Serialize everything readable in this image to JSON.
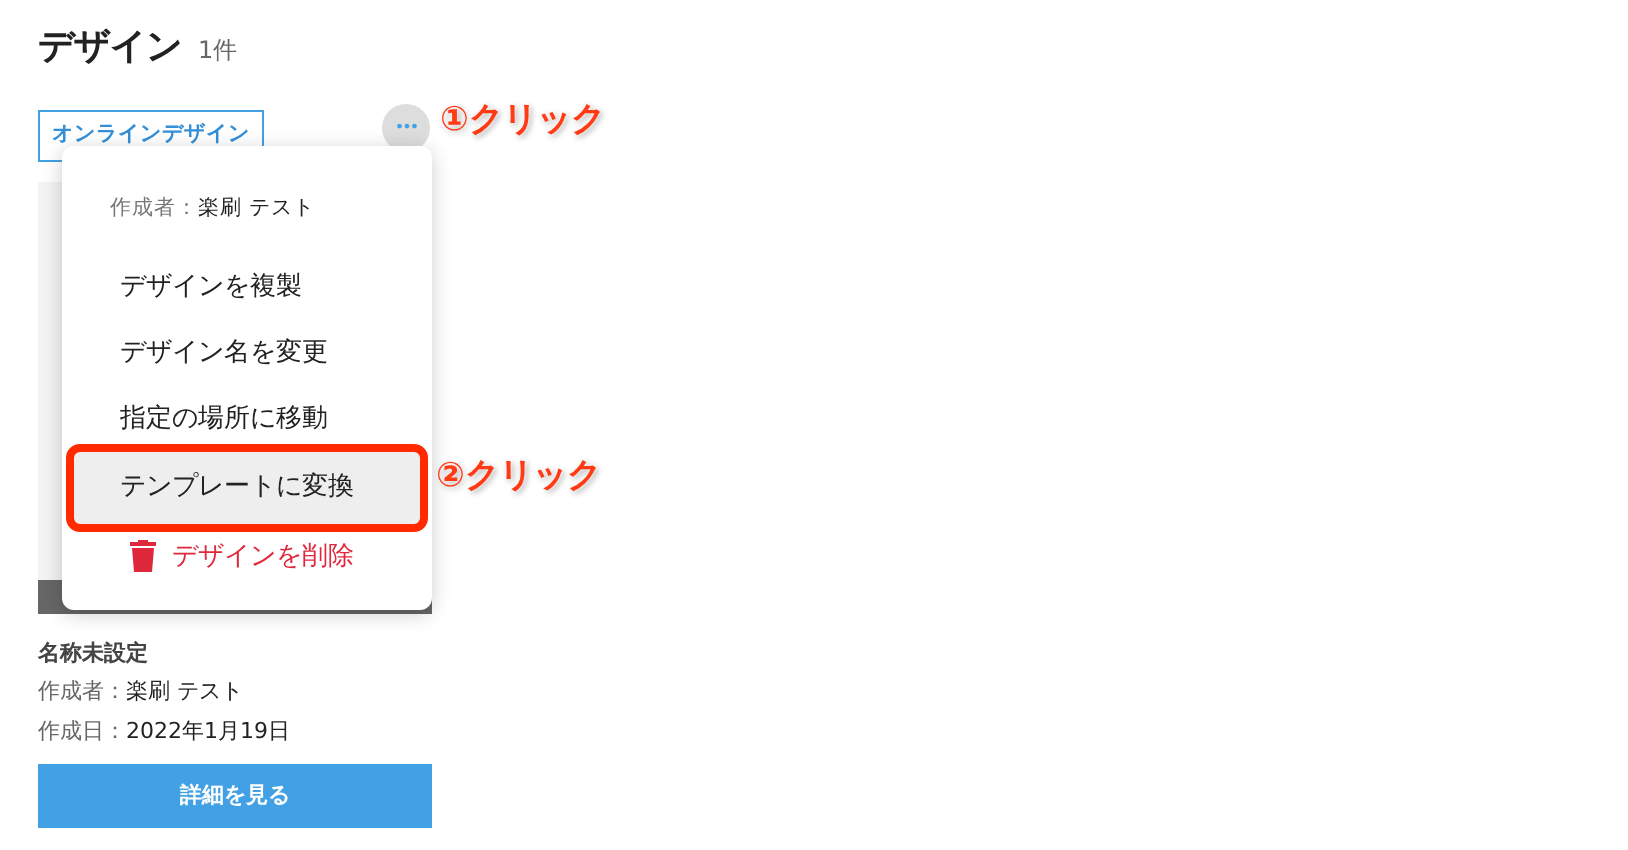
{
  "header": {
    "title": "デザイン",
    "count": "1件"
  },
  "tag": "オンラインデザイン",
  "menu_button": {
    "label": "•••"
  },
  "menu": {
    "author_label": "作成者：",
    "author_value": "楽刷 テスト",
    "items": [
      {
        "label": "デザインを複製",
        "kind": "normal",
        "selected": false
      },
      {
        "label": "デザイン名を変更",
        "kind": "normal",
        "selected": false
      },
      {
        "label": "指定の場所に移動",
        "kind": "normal",
        "selected": false
      },
      {
        "label": "テンプレートに変換",
        "kind": "normal",
        "selected": true
      },
      {
        "label": "デザインを削除",
        "kind": "delete",
        "selected": false
      }
    ]
  },
  "annotations": [
    "①クリック",
    "②クリック"
  ],
  "card": {
    "name": "名称未設定",
    "fields": [
      {
        "label": "作成者：",
        "value": "楽刷 テスト"
      },
      {
        "label": "作成日：",
        "value": "2022年1月19日"
      }
    ],
    "button": "詳細を見る"
  }
}
